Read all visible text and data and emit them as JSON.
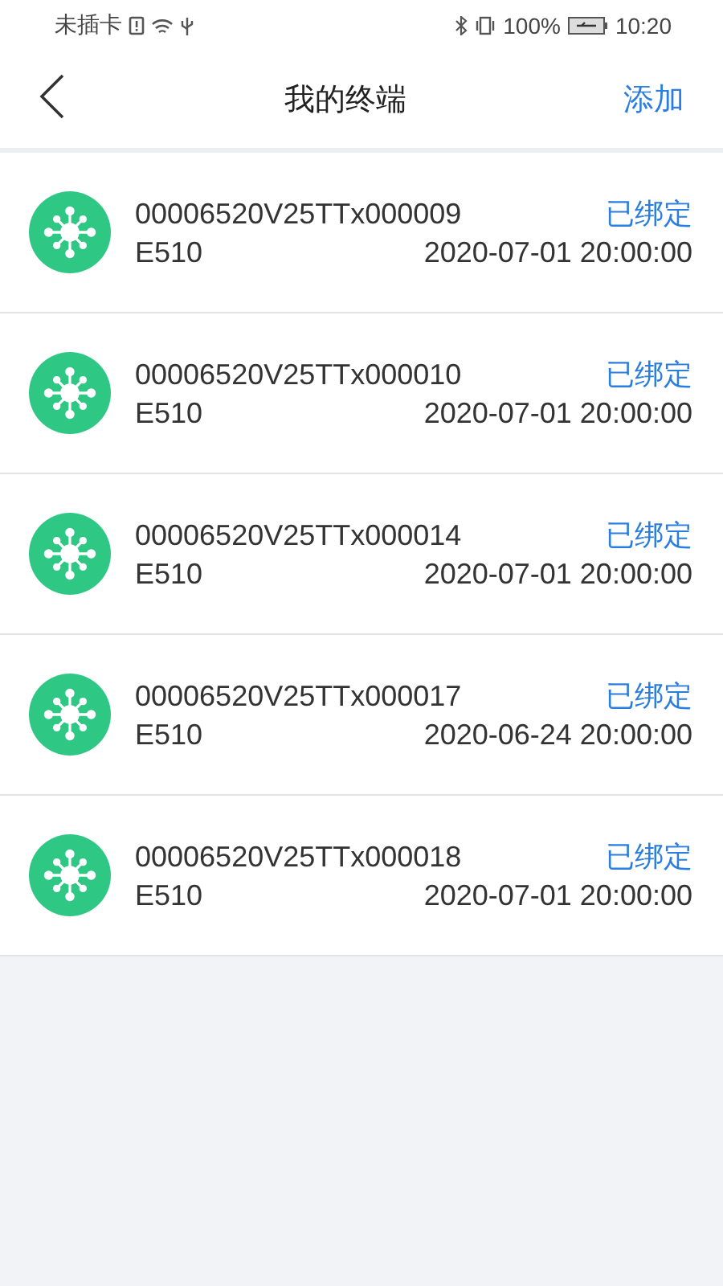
{
  "status_bar": {
    "carrier": "未插卡",
    "battery": "100%",
    "time": "10:20"
  },
  "nav": {
    "title": "我的终端",
    "action": "添加"
  },
  "devices": [
    {
      "serial": "00006520V25TTx000009",
      "model": "E510",
      "status": "已绑定",
      "date": "2020-07-01 20:00:00"
    },
    {
      "serial": "00006520V25TTx000010",
      "model": "E510",
      "status": "已绑定",
      "date": "2020-07-01 20:00:00"
    },
    {
      "serial": "00006520V25TTx000014",
      "model": "E510",
      "status": "已绑定",
      "date": "2020-07-01 20:00:00"
    },
    {
      "serial": "00006520V25TTx000017",
      "model": "E510",
      "status": "已绑定",
      "date": "2020-06-24 20:00:00"
    },
    {
      "serial": "00006520V25TTx000018",
      "model": "E510",
      "status": "已绑定",
      "date": "2020-07-01 20:00:00"
    }
  ]
}
